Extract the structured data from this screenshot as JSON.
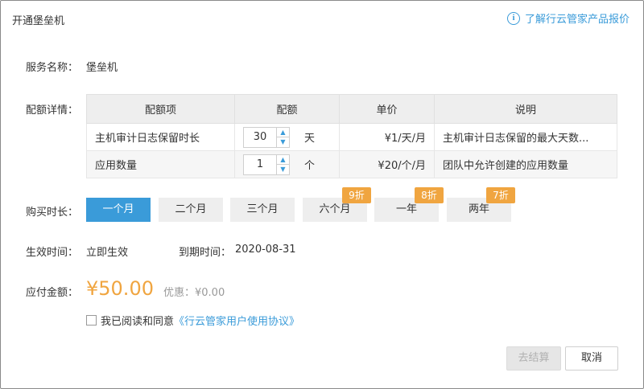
{
  "dialog": {
    "title": "开通堡垒机",
    "pricing_link": "了解行云管家产品报价",
    "info_icon": "i"
  },
  "service": {
    "label": "服务名称：",
    "value": "堡垒机"
  },
  "quota": {
    "label": "配额详情：",
    "headers": [
      "配额项",
      "配额",
      "单价",
      "说明"
    ],
    "rows": [
      {
        "item": "主机审计日志保留时长",
        "quota": "30",
        "unit": "天",
        "price": "¥1/天/月",
        "desc": "主机审计日志保留的最大天数..."
      },
      {
        "item": "应用数量",
        "quota": "1",
        "unit": "个",
        "price": "¥20/个/月",
        "desc": "团队中允许创建的应用数量"
      }
    ]
  },
  "duration": {
    "label": "购买时长：",
    "options": [
      {
        "label": "一个月",
        "discount": ""
      },
      {
        "label": "二个月",
        "discount": ""
      },
      {
        "label": "三个月",
        "discount": ""
      },
      {
        "label": "六个月",
        "discount": "9折"
      },
      {
        "label": "一年",
        "discount": "8折"
      },
      {
        "label": "两年",
        "discount": "7折"
      }
    ],
    "selected": "一个月"
  },
  "effective": {
    "label": "生效时间：",
    "value": "立即生效",
    "expire_label": "到期时间：",
    "expire_value": "2020-08-31"
  },
  "payment": {
    "label": "应付金额：",
    "amount": "¥50.00",
    "discount_text": "优惠：¥0.00"
  },
  "agreement": {
    "text": "我已阅读和同意",
    "link": "《行云管家用户使用协议》",
    "checked": false
  },
  "buttons": {
    "checkout": "去结算",
    "cancel": "取消"
  },
  "colors": {
    "accent": "#3a9bd9",
    "price": "#f0a540",
    "discount_badge": "#f0a540"
  }
}
